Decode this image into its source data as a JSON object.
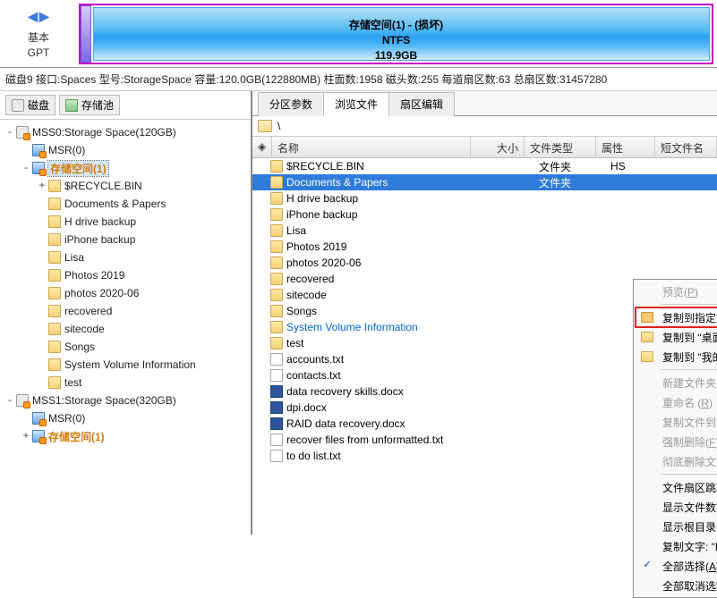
{
  "disk_header": {
    "left_label": "基本",
    "left_sub": "GPT",
    "bar_line1": "存储空间(1) - (损坏)",
    "bar_line2": "NTFS",
    "bar_line3": "119.9GB"
  },
  "info_line": "磁盘9 接口:Spaces 型号:StorageSpace 容量:120.0GB(122880MB) 柱面数:1958 磁头数:255 每道扇区数:63 总扇区数:31457280",
  "left_tabs": {
    "disk": "磁盘",
    "pool": "存储池"
  },
  "tree": [
    {
      "lvl": 0,
      "exp": "-",
      "icon": "disk",
      "lock": true,
      "label": "MSS0:Storage Space(120GB)",
      "cls": ""
    },
    {
      "lvl": 1,
      "exp": "",
      "icon": "part",
      "lock": true,
      "label": "MSR(0)",
      "cls": ""
    },
    {
      "lvl": 1,
      "exp": "-",
      "icon": "part",
      "lock": true,
      "label": "存储空间(1)",
      "cls": "orange sel"
    },
    {
      "lvl": 2,
      "exp": "+",
      "icon": "folder",
      "label": "$RECYCLE.BIN"
    },
    {
      "lvl": 2,
      "exp": "",
      "icon": "folder",
      "label": "Documents & Papers"
    },
    {
      "lvl": 2,
      "exp": "",
      "icon": "folder",
      "label": "H drive backup"
    },
    {
      "lvl": 2,
      "exp": "",
      "icon": "folder",
      "label": "iPhone backup"
    },
    {
      "lvl": 2,
      "exp": "",
      "icon": "folder",
      "label": "Lisa"
    },
    {
      "lvl": 2,
      "exp": "",
      "icon": "folder",
      "label": "Photos 2019"
    },
    {
      "lvl": 2,
      "exp": "",
      "icon": "folder",
      "label": "photos 2020-06"
    },
    {
      "lvl": 2,
      "exp": "",
      "icon": "folder",
      "label": "recovered"
    },
    {
      "lvl": 2,
      "exp": "",
      "icon": "folder",
      "label": "sitecode"
    },
    {
      "lvl": 2,
      "exp": "",
      "icon": "folder",
      "label": "Songs"
    },
    {
      "lvl": 2,
      "exp": "",
      "icon": "folder",
      "label": "System Volume Information"
    },
    {
      "lvl": 2,
      "exp": "",
      "icon": "folder",
      "label": "test"
    },
    {
      "lvl": 0,
      "exp": "-",
      "icon": "disk",
      "lock": true,
      "label": "MSS1:Storage Space(320GB)"
    },
    {
      "lvl": 1,
      "exp": "",
      "icon": "part",
      "lock": true,
      "label": "MSR(0)"
    },
    {
      "lvl": 1,
      "exp": "+",
      "icon": "part",
      "lock": true,
      "label": "存储空间(1)",
      "cls": "orange"
    }
  ],
  "right_tabs": {
    "t1": "分区参数",
    "t2": "浏览文件",
    "t3": "扇区编辑"
  },
  "path": "\\",
  "cols": {
    "name": "名称",
    "size": "大小",
    "type": "文件类型",
    "attr": "属性",
    "short": "短文件名"
  },
  "files": [
    {
      "icon": "folder",
      "name": "$RECYCLE.BIN",
      "type": "文件夹",
      "attr": "HS"
    },
    {
      "icon": "folder",
      "name": "Documents & Papers",
      "type": "文件夹",
      "sel": true
    },
    {
      "icon": "folder",
      "name": "H drive backup"
    },
    {
      "icon": "folder",
      "name": "iPhone backup"
    },
    {
      "icon": "folder",
      "name": "Lisa"
    },
    {
      "icon": "folder",
      "name": "Photos 2019"
    },
    {
      "icon": "folder",
      "name": "photos 2020-06"
    },
    {
      "icon": "folder",
      "name": "recovered"
    },
    {
      "icon": "folder",
      "name": "sitecode"
    },
    {
      "icon": "folder",
      "name": "Songs"
    },
    {
      "icon": "folder",
      "name": "System Volume Information",
      "hl": true
    },
    {
      "icon": "folder",
      "name": "test"
    },
    {
      "icon": "file",
      "name": "accounts.txt"
    },
    {
      "icon": "file",
      "name": "contacts.txt"
    },
    {
      "icon": "word",
      "name": "data recovery skills.docx"
    },
    {
      "icon": "word",
      "name": "dpi.docx"
    },
    {
      "icon": "word",
      "name": "RAID data recovery.docx"
    },
    {
      "icon": "file",
      "name": "recover files from unformatted.txt"
    },
    {
      "icon": "file",
      "name": "to do list.txt"
    }
  ],
  "ctx": {
    "preview": {
      "label": "预览",
      "u": "P",
      "disabled": true
    },
    "copy_to": {
      "label": "复制到指定文件夹",
      "u": "S",
      "tail": "...",
      "hl": true,
      "icon": "copy"
    },
    "copy_desk": {
      "label": "复制到 \"桌面\" ",
      "u": "E",
      "icon": "folder"
    },
    "copy_docs": {
      "label": "复制到 \"我的文档\" ",
      "u": "M",
      "icon": "folder"
    },
    "new_fold": {
      "label": "新建文件夹",
      "u": "N",
      "disabled": true
    },
    "rename": {
      "label": "重命名 ",
      "u": "R",
      "disabled": true
    },
    "copy_cur": {
      "label": "复制文件到当前分区",
      "u": "W",
      "disabled": true
    },
    "force_del": {
      "label": "强制删除",
      "u": "F",
      "disabled": true
    },
    "perm_del": {
      "label": "彻底删除文件 ",
      "u": "P",
      "disabled": true
    },
    "jump": {
      "label": "文件扇区跳转"
    },
    "clus_file": {
      "label": "显示文件数据所占用的簇列表"
    },
    "clus_root": {
      "label": "显示根目录占用的簇列表"
    },
    "copy_text": {
      "label": "复制文字: \"Documents  Papers\" 到剪贴板",
      "u": "C"
    },
    "sel_all": {
      "label": "全部选择",
      "u": "A",
      "icon": "check"
    },
    "desel_all": {
      "label": "全部取消选择",
      "u": "U"
    }
  }
}
